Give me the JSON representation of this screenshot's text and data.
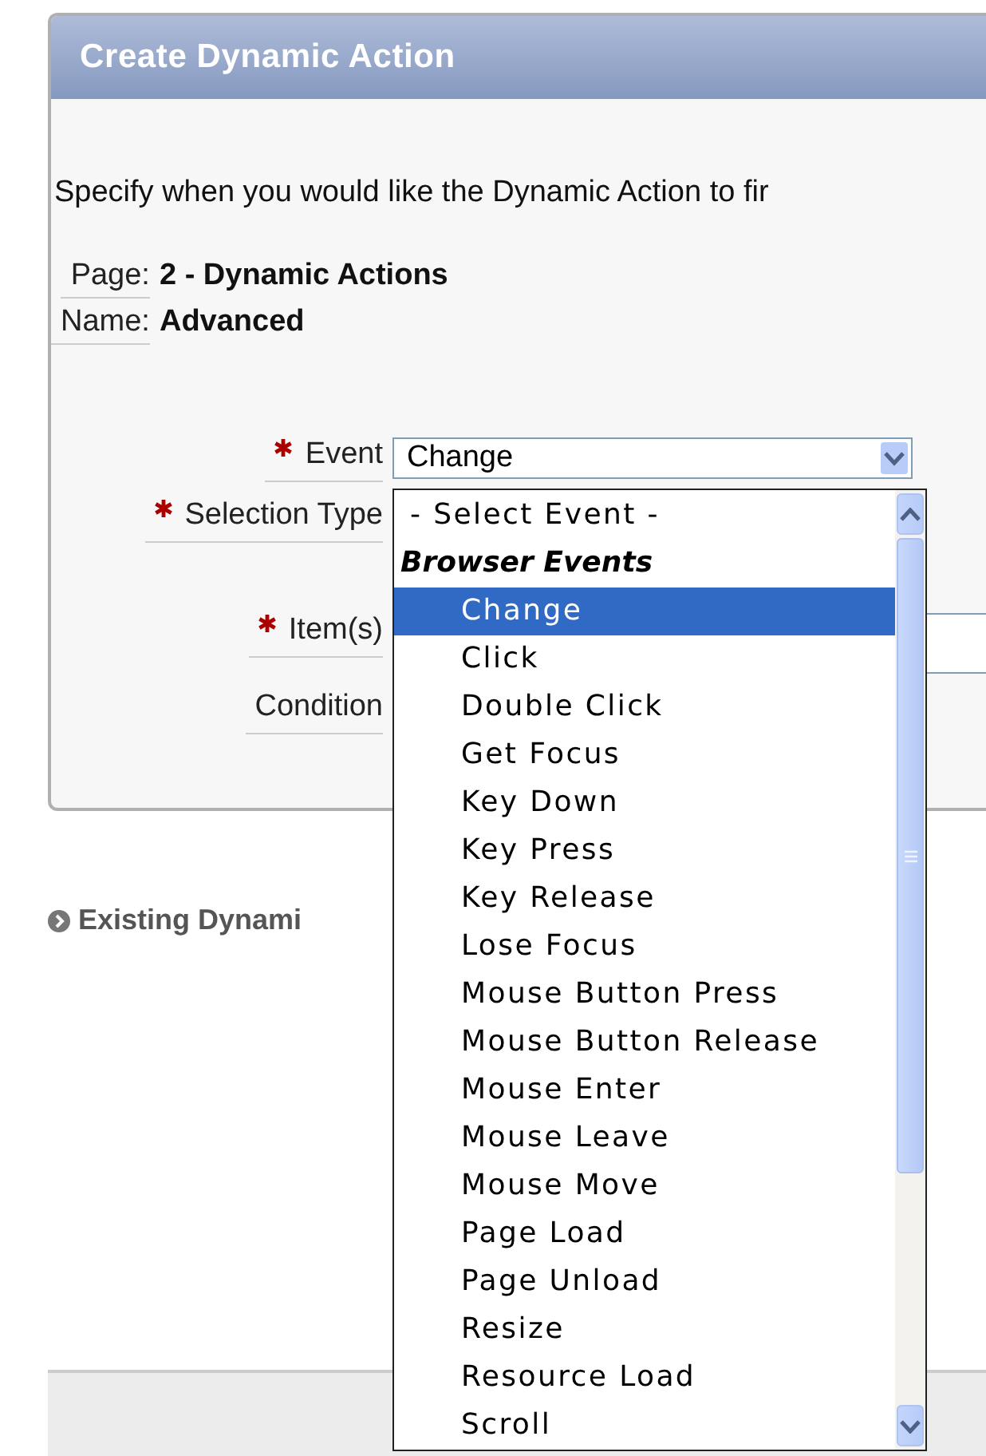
{
  "panel": {
    "title": "Create Dynamic Action",
    "description": "Specify when you would like the Dynamic Action to fir",
    "details": [
      {
        "label": "Page:",
        "value": "2 - Dynamic Actions"
      },
      {
        "label": "Name:",
        "value": "Advanced"
      }
    ],
    "fields": [
      {
        "label": "Event",
        "required": true,
        "kind": "select",
        "value": "Change",
        "expanded": true
      },
      {
        "label": "Selection Type",
        "required": true,
        "kind": "select"
      },
      {
        "label": "Item(s)",
        "required": true,
        "kind": "text"
      },
      {
        "label": "Condition",
        "required": false,
        "kind": "select"
      }
    ]
  },
  "dropdown": {
    "options": [
      {
        "kind": "option",
        "label": "- Select Event -",
        "selected": false
      },
      {
        "kind": "group",
        "label": "Browser Events",
        "children": [
          {
            "label": "Change",
            "selected": true
          },
          {
            "label": "Click",
            "selected": false
          },
          {
            "label": "Double Click",
            "selected": false
          },
          {
            "label": "Get Focus",
            "selected": false
          },
          {
            "label": "Key Down",
            "selected": false
          },
          {
            "label": "Key Press",
            "selected": false
          },
          {
            "label": "Key Release",
            "selected": false
          },
          {
            "label": "Lose Focus",
            "selected": false
          },
          {
            "label": "Mouse Button Press",
            "selected": false
          },
          {
            "label": "Mouse Button Release",
            "selected": false
          },
          {
            "label": "Mouse Enter",
            "selected": false
          },
          {
            "label": "Mouse Leave",
            "selected": false
          },
          {
            "label": "Mouse Move",
            "selected": false
          },
          {
            "label": "Page Load",
            "selected": false
          },
          {
            "label": "Page Unload",
            "selected": false
          },
          {
            "label": "Resize",
            "selected": false
          },
          {
            "label": "Resource Load",
            "selected": false
          },
          {
            "label": "Scroll",
            "selected": false
          }
        ]
      }
    ]
  },
  "existing_section": {
    "title": "Existing Dynami"
  }
}
